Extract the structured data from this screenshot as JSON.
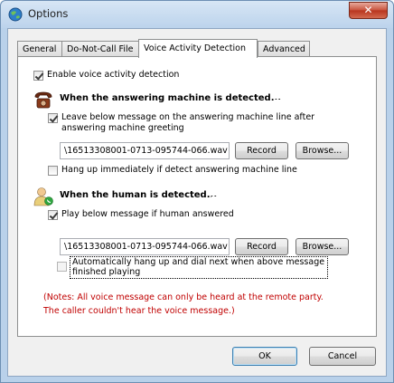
{
  "window": {
    "title": "Options",
    "close_glyph": "✕"
  },
  "tabs": [
    {
      "label": "General"
    },
    {
      "label": "Do-Not-Call File"
    },
    {
      "label": "Voice Activity Detection",
      "active": true
    },
    {
      "label": "Advanced"
    }
  ],
  "vad": {
    "enable_label": "Enable voice activity detection",
    "enable_checked": true
  },
  "machine": {
    "header": "When the answering machine is detected...",
    "icon": "telephone-icon",
    "leave_msg_line1": "Leave below message on the answering machine line after",
    "leave_msg_line2": "answering machine greeting",
    "leave_msg_checked": true,
    "file_path": "\\16513308001-0713-095744-066.wav",
    "record_label": "Record",
    "browse_label": "Browse...",
    "hangup_label": "Hang up immediately if detect answering machine line",
    "hangup_checked": false
  },
  "human": {
    "header": "When the human is detected...",
    "icon": "person-phone-icon",
    "play_msg_label": "Play below message if human answered",
    "play_msg_checked": true,
    "file_path": "\\16513308001-0713-095744-066.wav",
    "record_label": "Record",
    "browse_label": "Browse...",
    "auto_hangup_line1": "Automatically hang up and dial next when above message",
    "auto_hangup_line2": "finished playing",
    "auto_hangup_checked": false
  },
  "notes": {
    "line1": "(Notes: All voice message can only be heard at the remote party.",
    "line2": "The caller couldn't hear the voice message.)"
  },
  "footer": {
    "ok_label": "OK",
    "cancel_label": "Cancel"
  },
  "colors": {
    "note": "#c00000",
    "title_bar": "#bcd3ec",
    "close": "#c7503a"
  }
}
